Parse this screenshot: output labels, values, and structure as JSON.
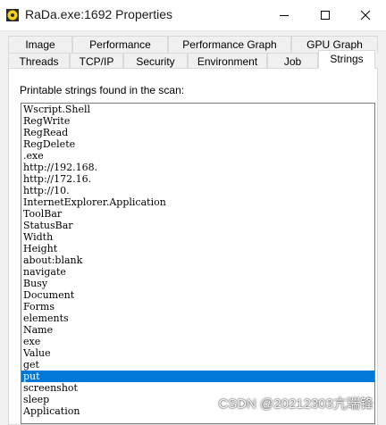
{
  "window": {
    "title": "RaDa.exe:1692 Properties"
  },
  "tabs_row1": [
    {
      "label": "Image"
    },
    {
      "label": "Performance"
    },
    {
      "label": "Performance Graph"
    },
    {
      "label": "GPU Graph"
    }
  ],
  "tabs_row2": [
    {
      "label": "Threads"
    },
    {
      "label": "TCP/IP"
    },
    {
      "label": "Security"
    },
    {
      "label": "Environment"
    },
    {
      "label": "Job"
    },
    {
      "label": "Strings"
    }
  ],
  "active_tab": "Strings",
  "strings_panel": {
    "label": "Printable strings found in the scan:",
    "items": [
      "Wscript.Shell",
      "RegWrite",
      "RegRead",
      "RegDelete",
      ".exe",
      "http://192.168.",
      "http://172.16.",
      "http://10.",
      "InternetExplorer.Application",
      "ToolBar",
      "StatusBar",
      "Width",
      "Height",
      "about:blank",
      "navigate",
      "Busy",
      "Document",
      "Forms",
      "elements",
      "Name",
      "exe",
      "Value",
      "get",
      "put",
      "screenshot",
      "sleep",
      "Application"
    ],
    "selected_item": "put"
  },
  "watermark": "CSDN @20212303亢瑞锋",
  "colors": {
    "selection": "#0078d7",
    "tab_border": "#d9d9d9"
  }
}
